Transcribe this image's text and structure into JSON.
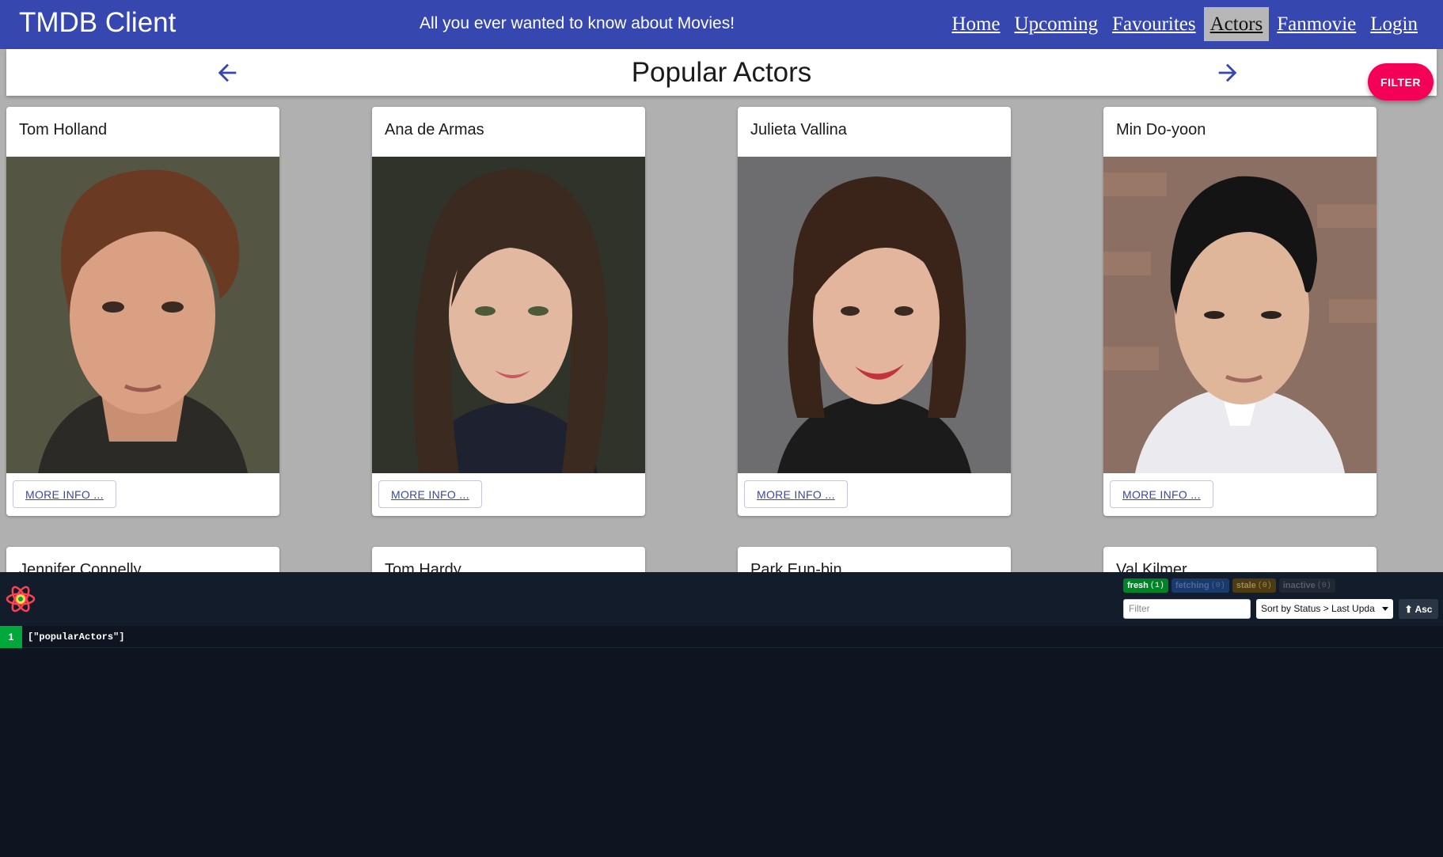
{
  "appbar": {
    "title": "TMDB Client",
    "tagline": "All you ever wanted to know about Movies!",
    "nav": [
      {
        "label": "Home",
        "active": false
      },
      {
        "label": "Upcoming",
        "active": false
      },
      {
        "label": "Favourites",
        "active": false
      },
      {
        "label": "Actors",
        "active": true
      },
      {
        "label": "Fanmovie",
        "active": false
      },
      {
        "label": "Login",
        "active": false
      }
    ]
  },
  "header": {
    "title": "Popular Actors",
    "left_icon": "arrow-back-icon",
    "right_icon": "arrow-forward-icon"
  },
  "filter_button": "FILTER",
  "actors": [
    {
      "name": "Tom Holland",
      "button": "MORE INFO ..."
    },
    {
      "name": "Ana de Armas",
      "button": "MORE INFO ..."
    },
    {
      "name": "Julieta Vallina",
      "button": "MORE INFO ..."
    },
    {
      "name": "Min Do-yoon",
      "button": "MORE INFO ..."
    },
    {
      "name": "Jennifer Connelly"
    },
    {
      "name": "Tom Hardy"
    },
    {
      "name": "Park Eun-bin"
    },
    {
      "name": "Val Kilmer"
    }
  ],
  "devtools": {
    "logo_icon": "react-query-logo-icon",
    "badges": {
      "fresh": {
        "label": "fresh",
        "count": "(1)"
      },
      "fetching": {
        "label": "fetching",
        "count": "(0)"
      },
      "stale": {
        "label": "stale",
        "count": "(0)"
      },
      "inactive": {
        "label": "inactive",
        "count": "(0)"
      }
    },
    "filter_placeholder": "Filter",
    "sort_label": "Sort by Status > Last Upda",
    "asc_label": "⬆ Asc",
    "queries": [
      {
        "count": "1",
        "key": "[\"popularActors\"]"
      }
    ]
  },
  "colors": {
    "appbar": "#3647b0",
    "fab": "#f50057",
    "fresh": "#00a83c",
    "devtools_bg": "#0f1520"
  }
}
